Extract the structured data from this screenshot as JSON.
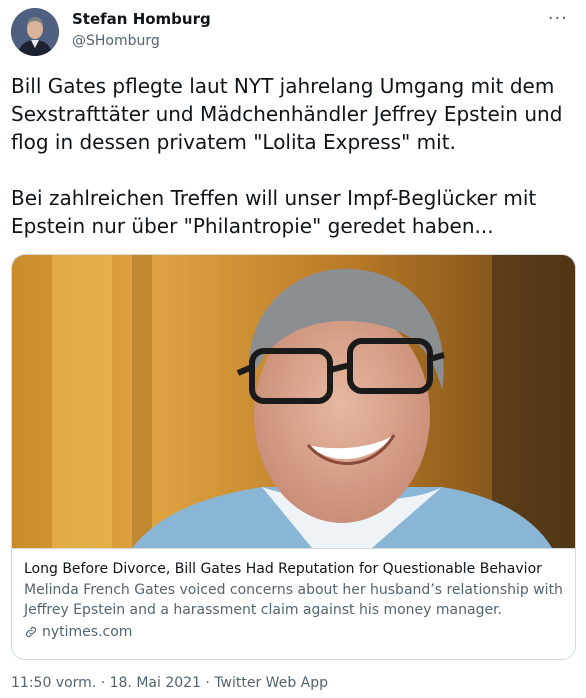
{
  "author": {
    "name": "Stefan Homburg",
    "handle": "@SHomburg",
    "avatar_icon": "person-avatar-icon"
  },
  "more_icon": "ellipsis-icon",
  "tweet": {
    "paragraph1": "Bill Gates pflegte laut NYT jahrelang Umgang mit dem Sexstrafttäter und Mädchenhändler Jeffrey Epstein und flog in dessen privatem \"Lolita Express\" mit.",
    "paragraph2": "Bei zahlreichen Treffen will unser Impf-Beglücker mit Epstein nur über \"Philantropie\" geredet haben..."
  },
  "card": {
    "image_icon": "portrait-photo",
    "title": "Long Before Divorce, Bill Gates Had Reputation for Questionable Behavior",
    "description": "Melinda French Gates voiced concerns about her husband’s relationship with Jeffrey Epstein and a harassment claim against his money manager.",
    "domain": "nytimes.com",
    "domain_icon": "link-icon"
  },
  "meta": {
    "time": "11:50 vorm.",
    "separator1": " · ",
    "date": "18. Mai 2021",
    "separator2": " · ",
    "source": "Twitter Web App"
  },
  "colors": {
    "text_primary": "#0f1419",
    "text_secondary": "#536471",
    "border": "#cfd9de"
  }
}
